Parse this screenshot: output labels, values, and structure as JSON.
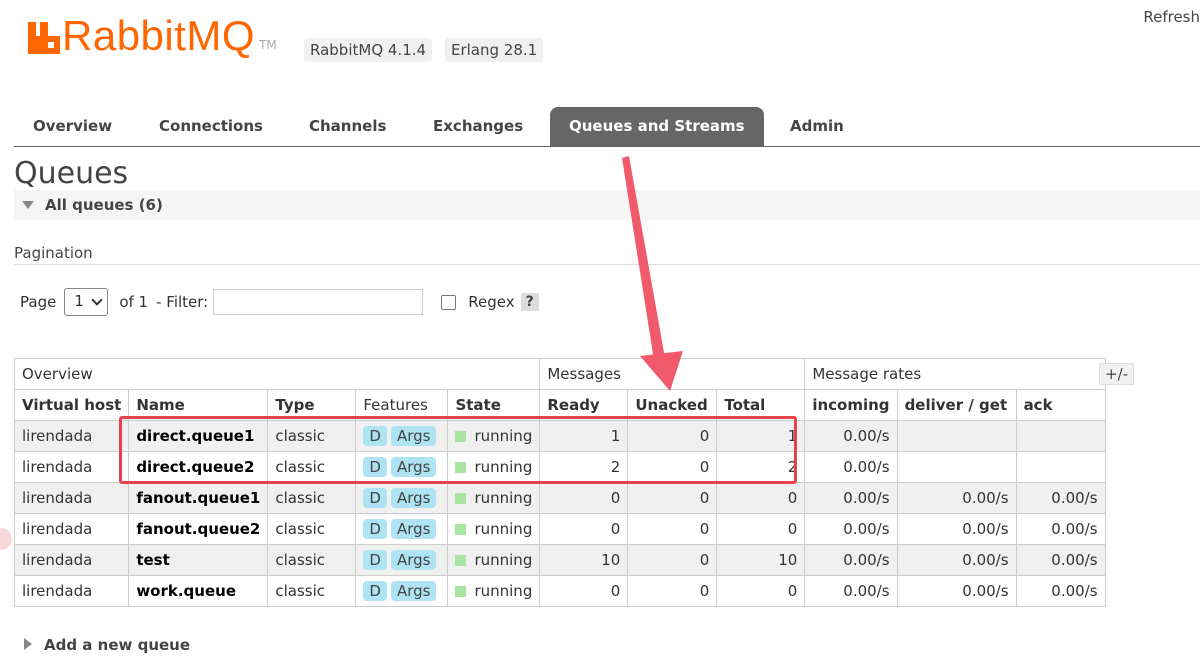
{
  "header": {
    "logo_text": "RabbitMQ",
    "logo_tm": "TM",
    "version_rabbit": "RabbitMQ 4.1.4",
    "version_erlang": "Erlang 28.1",
    "refresh_label": "Refresh"
  },
  "nav": {
    "tabs": [
      {
        "label": "Overview"
      },
      {
        "label": "Connections"
      },
      {
        "label": "Channels"
      },
      {
        "label": "Exchanges"
      },
      {
        "label": "Queues and Streams",
        "active": true
      },
      {
        "label": "Admin"
      }
    ]
  },
  "page": {
    "title": "Queues",
    "section_label": "All queues (6)",
    "pagination_title": "Pagination",
    "page_label": "Page",
    "page_value": "1",
    "of_label": "of 1",
    "filter_label": "- Filter:",
    "filter_value": "",
    "regex_label": "Regex",
    "help_label": "?",
    "plusminus_label": "+/-",
    "add_queue_label": "Add a new queue"
  },
  "table": {
    "groups": [
      "Overview",
      "Messages",
      "Message rates"
    ],
    "columns": [
      "Virtual host",
      "Name",
      "Type",
      "Features",
      "State",
      "Ready",
      "Unacked",
      "Total",
      "incoming",
      "deliver / get",
      "ack"
    ],
    "rows": [
      {
        "vhost": "lirendada",
        "name": "direct.queue1",
        "type": "classic",
        "f1": "D",
        "f2": "Args",
        "state": "running",
        "ready": "1",
        "unacked": "0",
        "total": "1",
        "incoming": "0.00/s",
        "deliver": "",
        "ack": ""
      },
      {
        "vhost": "lirendada",
        "name": "direct.queue2",
        "type": "classic",
        "f1": "D",
        "f2": "Args",
        "state": "running",
        "ready": "2",
        "unacked": "0",
        "total": "2",
        "incoming": "0.00/s",
        "deliver": "",
        "ack": ""
      },
      {
        "vhost": "lirendada",
        "name": "fanout.queue1",
        "type": "classic",
        "f1": "D",
        "f2": "Args",
        "state": "running",
        "ready": "0",
        "unacked": "0",
        "total": "0",
        "incoming": "0.00/s",
        "deliver": "0.00/s",
        "ack": "0.00/s"
      },
      {
        "vhost": "lirendada",
        "name": "fanout.queue2",
        "type": "classic",
        "f1": "D",
        "f2": "Args",
        "state": "running",
        "ready": "0",
        "unacked": "0",
        "total": "0",
        "incoming": "0.00/s",
        "deliver": "0.00/s",
        "ack": "0.00/s"
      },
      {
        "vhost": "lirendada",
        "name": "test",
        "type": "classic",
        "f1": "D",
        "f2": "Args",
        "state": "running",
        "ready": "10",
        "unacked": "0",
        "total": "10",
        "incoming": "0.00/s",
        "deliver": "0.00/s",
        "ack": "0.00/s"
      },
      {
        "vhost": "lirendada",
        "name": "work.queue",
        "type": "classic",
        "f1": "D",
        "f2": "Args",
        "state": "running",
        "ready": "0",
        "unacked": "0",
        "total": "0",
        "incoming": "0.00/s",
        "deliver": "0.00/s",
        "ack": "0.00/s"
      }
    ]
  },
  "colors": {
    "brand": "#ff6600",
    "active_tab": "#666666",
    "annotation": "#e8414e",
    "feature_badge": "#aee3f4",
    "running": "#a8e5a0"
  }
}
